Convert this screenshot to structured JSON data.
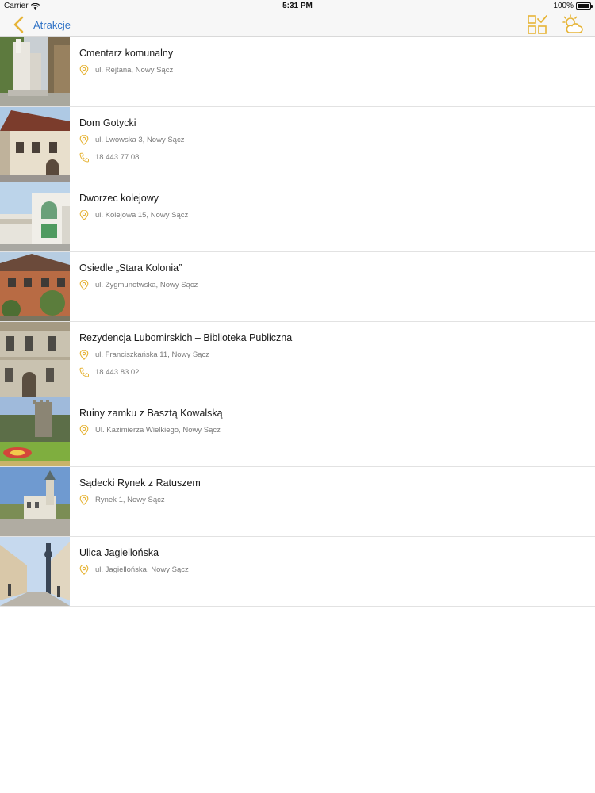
{
  "status_bar": {
    "carrier": "Carrier",
    "time": "5:31 PM",
    "battery": "100%"
  },
  "nav": {
    "back_label": "Atrakcje"
  },
  "colors": {
    "accent": "#e6b437",
    "link": "#2f72c6",
    "text": "#1a1a1a",
    "secondary": "#7a7a7a"
  },
  "items": [
    {
      "name": "Cmentarz komunalny",
      "address": "ul. Rejtana, Nowy Sącz",
      "phone": ""
    },
    {
      "name": "Dom Gotycki",
      "address": "ul. Lwowska 3, Nowy Sącz",
      "phone": "18 443 77 08"
    },
    {
      "name": "Dworzec kolejowy",
      "address": "ul. Kolejowa 15, Nowy Sącz",
      "phone": ""
    },
    {
      "name": "Osiedle „Stara Kolonia”",
      "address": "ul. Zygmunotwska, Nowy Sącz",
      "phone": ""
    },
    {
      "name": "Rezydencja Lubomirskich – Biblioteka Publiczna",
      "address": "ul. Franciszkańska 11, Nowy Sącz",
      "phone": "18 443 83 02"
    },
    {
      "name": "Ruiny zamku z Basztą Kowalską",
      "address": "Ul. Kazimierza Wielkiego, Nowy Sącz",
      "phone": ""
    },
    {
      "name": "Sądecki Rynek z Ratuszem",
      "address": "Rynek 1, Nowy Sącz",
      "phone": ""
    },
    {
      "name": "Ulica Jagiellońska",
      "address": "ul. Jagiellońska, Nowy Sącz",
      "phone": ""
    }
  ]
}
